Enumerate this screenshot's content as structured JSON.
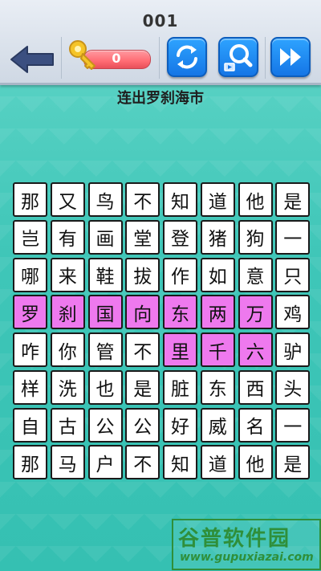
{
  "header": {
    "level": "001",
    "keys": "0"
  },
  "hint": "连出罗刹海市",
  "grid": {
    "rows": [
      [
        "那",
        "又",
        "鸟",
        "不",
        "知",
        "道",
        "他",
        "是"
      ],
      [
        "岂",
        "有",
        "画",
        "堂",
        "登",
        "猪",
        "狗",
        "一"
      ],
      [
        "哪",
        "来",
        "鞋",
        "拔",
        "作",
        "如",
        "意",
        "只"
      ],
      [
        "罗",
        "刹",
        "国",
        "向",
        "东",
        "两",
        "万",
        "鸡"
      ],
      [
        "咋",
        "你",
        "管",
        "不",
        "里",
        "千",
        "六",
        "驴"
      ],
      [
        "样",
        "洗",
        "也",
        "是",
        "脏",
        "东",
        "西",
        "头"
      ],
      [
        "自",
        "古",
        "公",
        "公",
        "好",
        "威",
        "名",
        "一"
      ],
      [
        "那",
        "马",
        "户",
        "不",
        "知",
        "道",
        "他",
        "是"
      ]
    ],
    "selected_cells": [
      [
        3,
        0
      ],
      [
        3,
        1
      ],
      [
        3,
        2
      ],
      [
        3,
        3
      ],
      [
        3,
        4
      ],
      [
        3,
        5
      ],
      [
        3,
        6
      ],
      [
        4,
        4
      ],
      [
        4,
        5
      ],
      [
        4,
        6
      ]
    ],
    "selected_color": "#ee79ee"
  },
  "colors": {
    "button_blue": "#1576e6",
    "key_bar": "#ff6b73",
    "background": "#3fc6b8"
  },
  "watermark": {
    "title": "谷普软件园",
    "url": "www.gupuxiazai.com"
  }
}
